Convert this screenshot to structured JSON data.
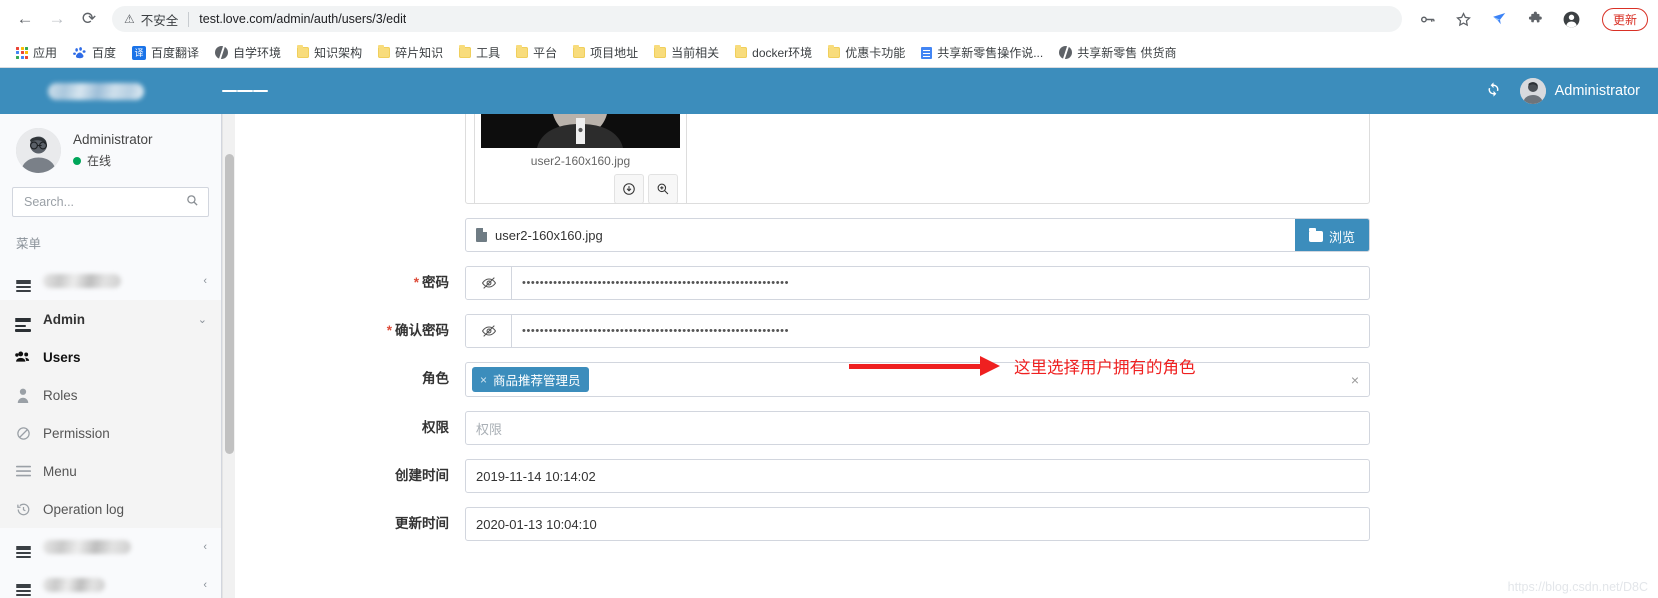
{
  "browser": {
    "nav": {
      "back": "←",
      "forward": "→",
      "reload": "⟳"
    },
    "security_label": "不安全",
    "warning_icon": "⚠",
    "url": "test.love.com/admin/auth/users/3/edit",
    "toolbar_icons": [
      {
        "name": "password-key-icon",
        "glyph": "⚷"
      },
      {
        "name": "bookmark-star-icon",
        "glyph": "☆"
      },
      {
        "name": "extension-blue-icon",
        "glyph": "✦"
      },
      {
        "name": "extensions-puzzle-icon",
        "glyph": "✜"
      },
      {
        "name": "profile-avatar-icon",
        "glyph": "●"
      }
    ],
    "update_label": "更新",
    "bookmarks": [
      {
        "label": "应用",
        "icon": "apps-grid-icon"
      },
      {
        "label": "百度",
        "icon": "baidu-icon"
      },
      {
        "label": "百度翻译",
        "icon": "translate-icon"
      },
      {
        "label": "自学环境",
        "icon": "globe-icon"
      },
      {
        "label": "知识架构",
        "icon": "folder-icon"
      },
      {
        "label": "碎片知识",
        "icon": "folder-icon"
      },
      {
        "label": "工具",
        "icon": "folder-icon"
      },
      {
        "label": "平台",
        "icon": "folder-icon"
      },
      {
        "label": "项目地址",
        "icon": "folder-icon"
      },
      {
        "label": "当前相关",
        "icon": "folder-icon"
      },
      {
        "label": "docker环境",
        "icon": "folder-icon"
      },
      {
        "label": "优惠卡功能",
        "icon": "folder-icon"
      },
      {
        "label": "共享新零售操作说...",
        "icon": "doc-icon"
      },
      {
        "label": "共享新零售 供货商",
        "icon": "globe-icon"
      }
    ]
  },
  "app": {
    "brand_label": "",
    "topbar": {
      "menu_toggle": "hamburger-icon",
      "refresh_icon": "⟳",
      "username": "Administrator"
    },
    "sidebar": {
      "user": {
        "name": "Administrator",
        "status": "在线"
      },
      "search": {
        "placeholder": "Search...",
        "value": ""
      },
      "section_title": "菜单",
      "items": [
        {
          "label": "",
          "icon": "hamburger-icon",
          "caret": "‹",
          "blurred": true,
          "blur_width": 78
        },
        {
          "label": "Admin",
          "icon": "list-bars-icon",
          "caret": "⌄",
          "blurred": false
        },
        {
          "label": "Users",
          "icon": "users-icon",
          "selected": true,
          "blurred": false
        },
        {
          "label": "Roles",
          "icon": "person-icon",
          "blurred": false
        },
        {
          "label": "Permission",
          "icon": "ban-circle-icon",
          "blurred": false
        },
        {
          "label": "Menu",
          "icon": "bars-icon",
          "blurred": false
        },
        {
          "label": "Operation log",
          "icon": "history-clock-icon",
          "blurred": false
        },
        {
          "label": "",
          "icon": "hamburger-icon",
          "caret": "‹",
          "blurred": true,
          "blur_width": 88
        },
        {
          "label": "",
          "icon": "hamburger-icon",
          "caret": "‹",
          "blurred": true,
          "blur_width": 62
        }
      ]
    },
    "form": {
      "avatar_upload": {
        "thumb_filename": "user2-160x160.jpg",
        "download_icon": "⊕",
        "zoom_icon": "⊕"
      },
      "file_input": {
        "filename": "user2-160x160.jpg",
        "browse_label": "浏览"
      },
      "rows": [
        {
          "label": "密码",
          "required": true,
          "type": "password",
          "value": "••••••••••••••••••••••••••••••••••••••••••••••••••••••••••••"
        },
        {
          "label": "确认密码",
          "required": true,
          "type": "password",
          "value": "••••••••••••••••••••••••••••••••••••••••••••••••••••••••••••"
        },
        {
          "label": "角色",
          "required": false,
          "type": "tags",
          "tag": "商品推荐管理员",
          "tag_remove": "×",
          "clear": "×"
        },
        {
          "label": "权限",
          "required": false,
          "type": "text",
          "value": "",
          "placeholder": "权限"
        },
        {
          "label": "创建时间",
          "required": false,
          "type": "text",
          "value": "2019-11-14 10:14:02"
        },
        {
          "label": "更新时间",
          "required": false,
          "type": "text",
          "value": "2020-01-13 10:04:10"
        }
      ]
    },
    "annotation": {
      "text": "这里选择用户拥有的角色",
      "color": "#ef2020"
    },
    "watermark": "https://blog.csdn.net/D8C"
  },
  "colors": {
    "accent": "#3c8dbc",
    "annotation": "#ef2020",
    "required": "#dd4b39",
    "online": "#00a65a"
  }
}
